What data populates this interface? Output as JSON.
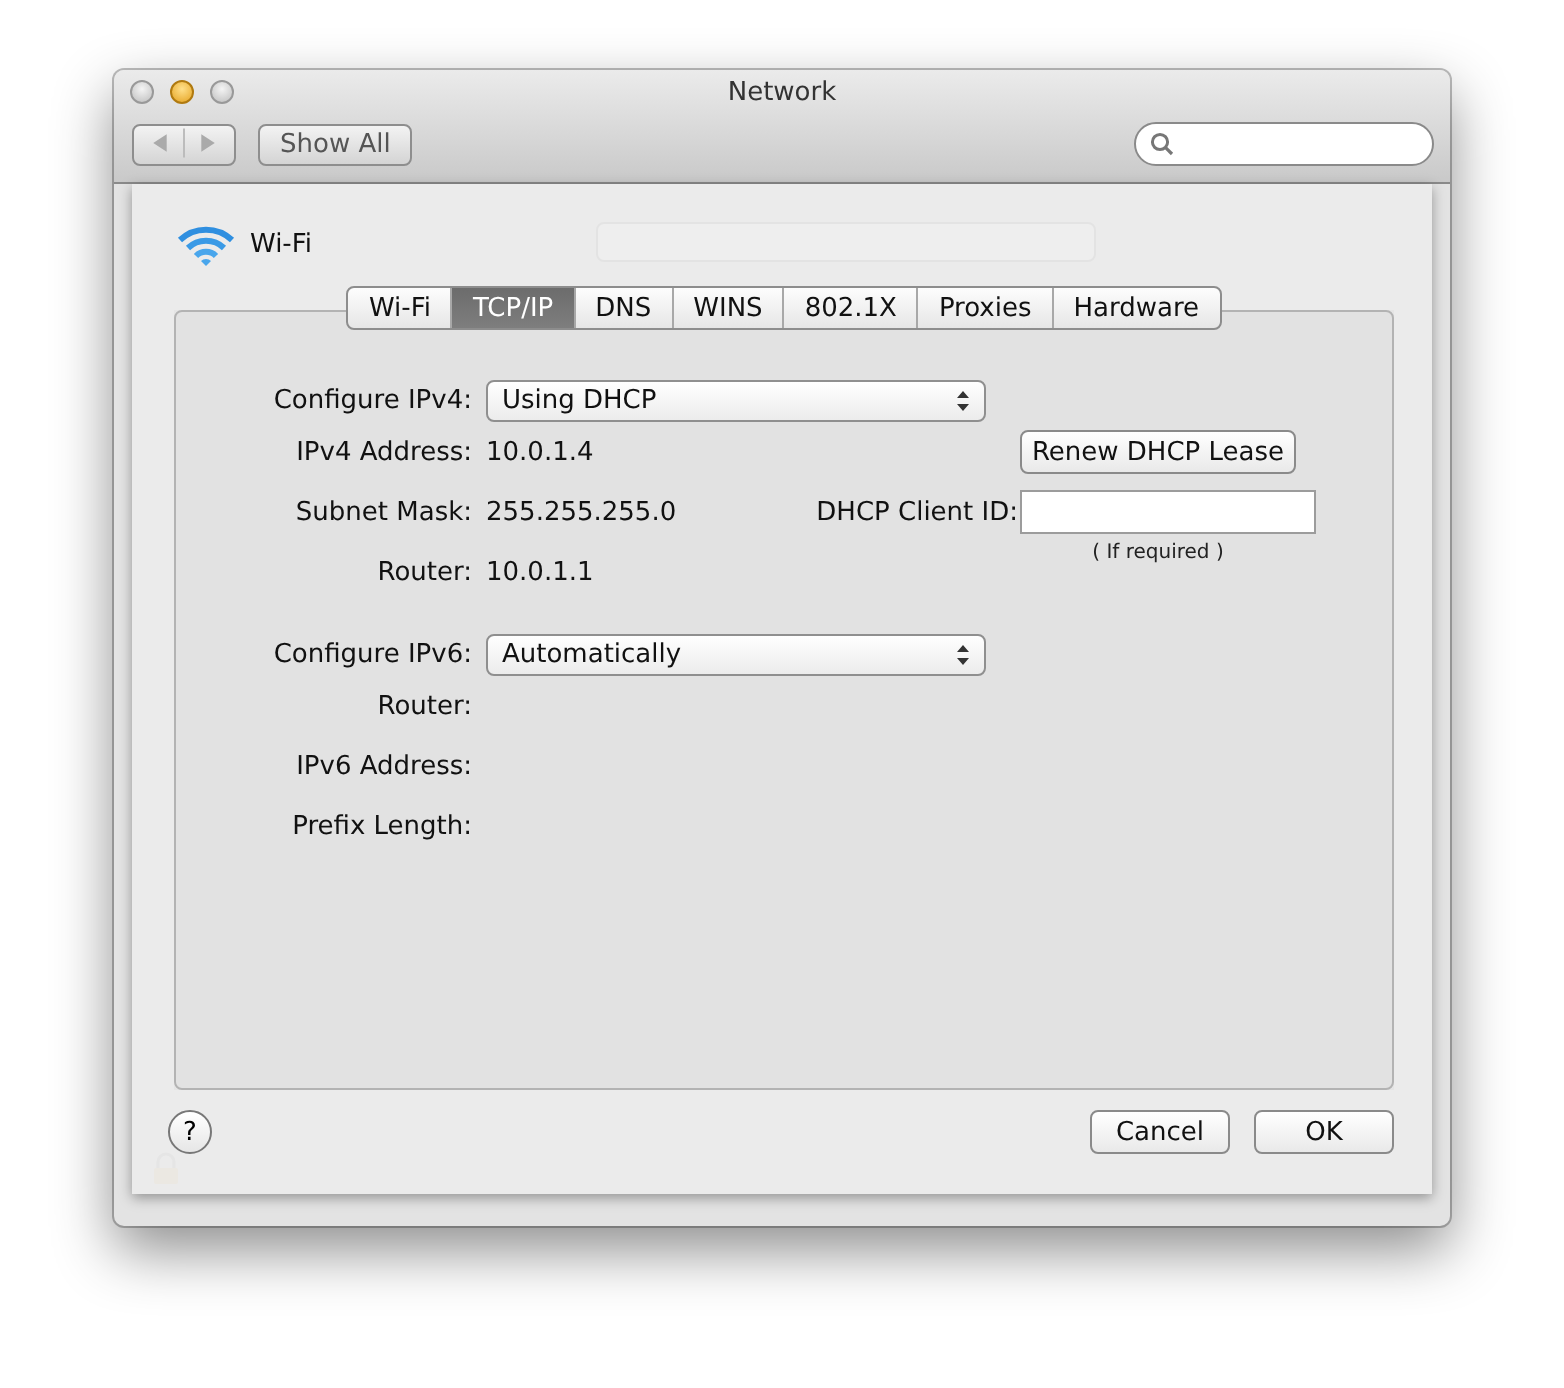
{
  "window": {
    "title": "Network",
    "show_all": "Show All"
  },
  "sheet": {
    "service": "Wi-Fi",
    "tabs": [
      {
        "label": "Wi-Fi",
        "selected": false
      },
      {
        "label": "TCP/IP",
        "selected": true
      },
      {
        "label": "DNS",
        "selected": false
      },
      {
        "label": "WINS",
        "selected": false
      },
      {
        "label": "802.1X",
        "selected": false
      },
      {
        "label": "Proxies",
        "selected": false
      },
      {
        "label": "Hardware",
        "selected": false
      }
    ],
    "rows": [
      {
        "kind": "popup",
        "label": "Configure IPv4:",
        "value": "Using DHCP"
      },
      {
        "kind": "text",
        "label": "IPv4 Address:",
        "value": "10.0.1.4"
      },
      {
        "kind": "text",
        "label": "Subnet Mask:",
        "value": "255.255.255.0"
      },
      {
        "kind": "text",
        "label": "Router:",
        "value": "10.0.1.1"
      },
      {
        "kind": "popup",
        "label": "Configure IPv6:",
        "value": "Automatically"
      },
      {
        "kind": "text",
        "label": "Router:"
      },
      {
        "kind": "text",
        "label": "IPv6 Address:"
      },
      {
        "kind": "text",
        "label": "Prefix Length:"
      }
    ],
    "renew_button": "Renew DHCP Lease",
    "client_id": {
      "label": "DHCP Client ID:",
      "caption": "( If required )"
    },
    "help": "?",
    "buttons": [
      "Cancel",
      "OK"
    ]
  }
}
